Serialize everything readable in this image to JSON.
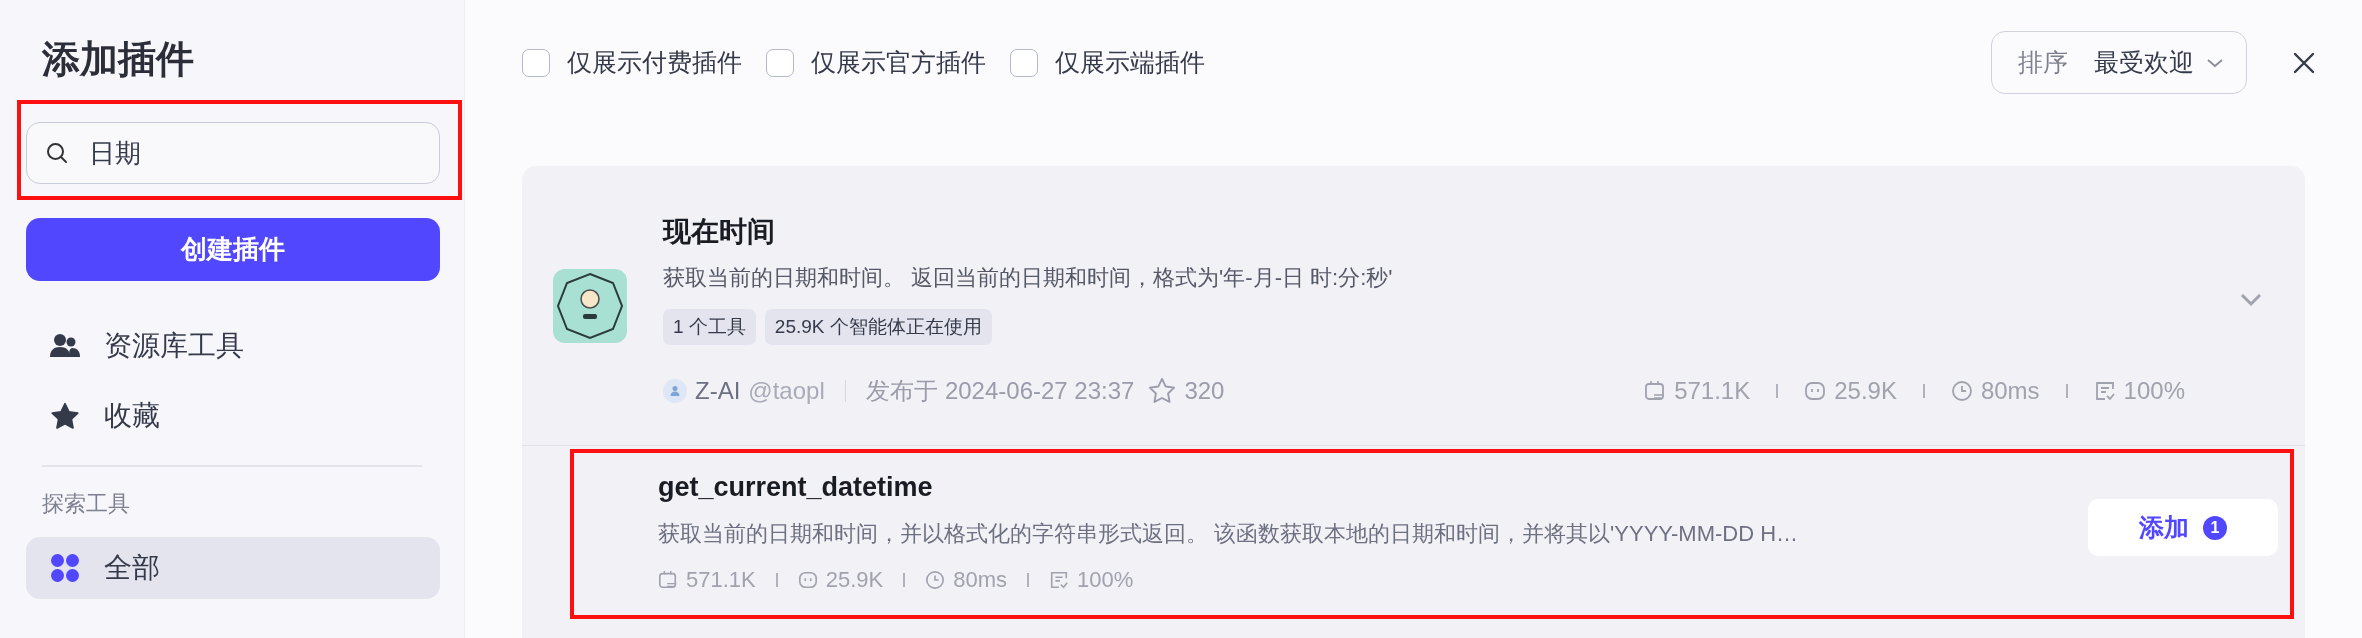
{
  "sidebar": {
    "title": "添加插件",
    "search": {
      "value": "日期"
    },
    "create_button": "创建插件",
    "library_items": [
      {
        "label": "资源库工具"
      },
      {
        "label": "收藏"
      }
    ],
    "section_title": "探索工具",
    "explore_items": [
      {
        "label": "全部",
        "selected": true
      }
    ]
  },
  "filters": [
    {
      "label": "仅展示付费插件",
      "checked": false
    },
    {
      "label": "仅展示官方插件",
      "checked": false
    },
    {
      "label": "仅展示端插件",
      "checked": false
    }
  ],
  "sort": {
    "label": "排序",
    "value": "最受欢迎"
  },
  "plugin": {
    "name": "现在时间",
    "description": "获取当前的日期和时间。 返回当前的日期和时间，格式为'年-月-日 时:分:秒'",
    "tags": [
      "1 个工具",
      "25.9K 个智能体正在使用"
    ],
    "author": "Z-AI",
    "handle": "@taopl",
    "published": "发布于 2024-06-27 23:37",
    "favorites": "320",
    "stats": [
      "571.1K",
      "25.9K",
      "80ms",
      "100%"
    ],
    "tools": [
      {
        "name": "get_current_datetime",
        "description": "获取当前的日期和时间，并以格式化的字符串形式返回。 该函数获取本地的日期和时间，并将其以'YYYY-MM-DD H…",
        "stats": [
          "571.1K",
          "25.9K",
          "80ms",
          "100%"
        ],
        "button": "添加",
        "count": "1"
      }
    ]
  }
}
